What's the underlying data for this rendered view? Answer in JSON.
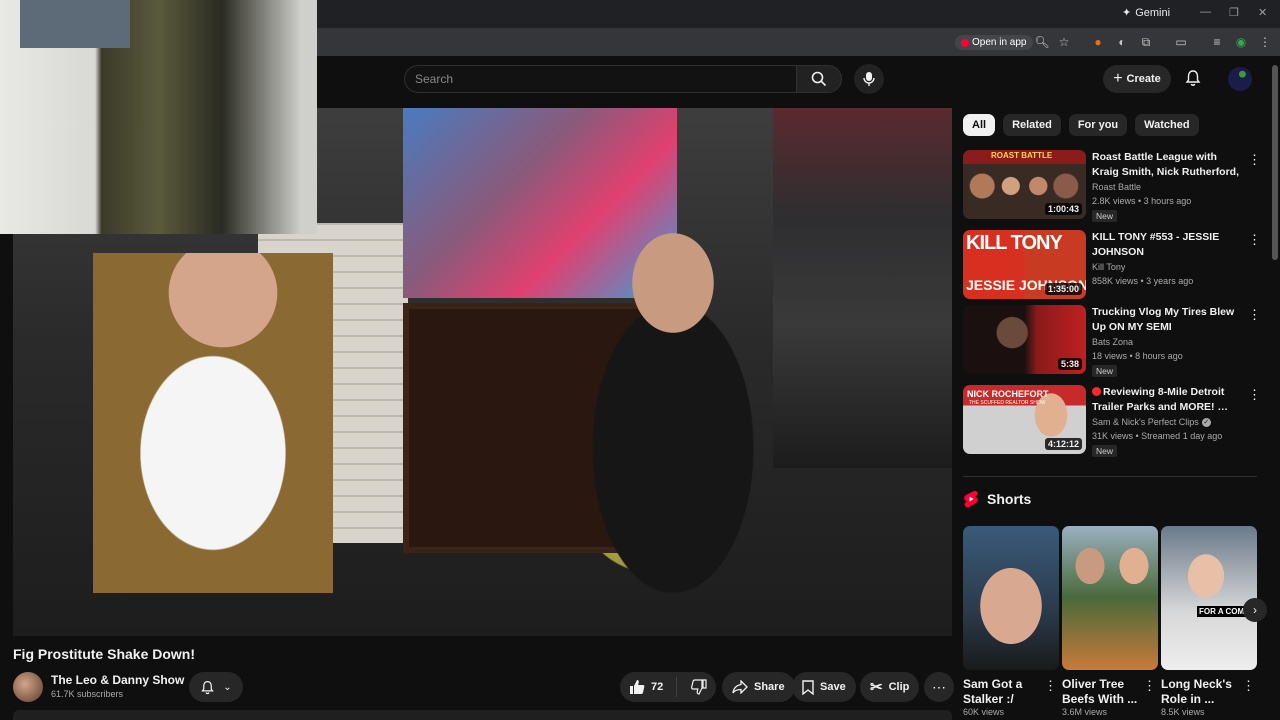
{
  "browser": {
    "gemini_label": "Gemini",
    "open_in_app": "Open in app"
  },
  "header": {
    "search_placeholder": "Search",
    "create_label": "Create"
  },
  "video": {
    "title": "Fig Prostitute Shake Down!",
    "channel": "The Leo & Danny Show",
    "subscribers": "61.7K subscribers",
    "likes": "72",
    "share_label": "Share",
    "save_label": "Save",
    "clip_label": "Clip"
  },
  "chips": [
    "All",
    "Related",
    "For you",
    "Watched"
  ],
  "recommendations": [
    {
      "title": "Roast Battle League with Kraig Smith, Nick Rutherford, Darius...",
      "channel": "Roast Battle",
      "meta": "2.8K views • 3 hours ago",
      "badge": "New",
      "duration": "1:00:43",
      "verified": false,
      "live_dot": false
    },
    {
      "title": "KILL TONY #553 - JESSIE JOHNSON",
      "channel": "Kill Tony",
      "meta": "858K views • 3 years ago",
      "badge": "",
      "duration": "1:35:00",
      "verified": false,
      "live_dot": false
    },
    {
      "title": "Trucking Vlog My Tires Blew Up ON MY SEMI",
      "channel": "Bats Zona",
      "meta": "18 views • 8 hours ago",
      "badge": "New",
      "duration": "5:38",
      "verified": false,
      "live_dot": false
    },
    {
      "title": "Reviewing 8-Mile Detroit Trailer Parks and MORE! …",
      "channel": "Sam & Nick's Perfect Clips",
      "meta": "31K views • Streamed 1 day ago",
      "badge": "New",
      "duration": "4:12:12",
      "verified": true,
      "live_dot": true
    }
  ],
  "shorts": {
    "heading": "Shorts",
    "items": [
      {
        "title": "Sam Got a Stalker :/",
        "views": "60K views"
      },
      {
        "title": "Oliver Tree Beefs With ...",
        "views": "3.6M views"
      },
      {
        "title": "Long Neck's Role in ...",
        "views": "8.5K views"
      }
    ]
  },
  "thumb_texts": {
    "rec1_top": "ROAST BATTLE",
    "rec2_text": "KILL TONY",
    "rec2_sub": "JESSIE JOHNSON",
    "rec4_name": "NICK ROCHEFORT",
    "rec4_sub": "THE SCUFFED REALTOR SHOW",
    "short3_caption": "FOR A COMPLIMENT"
  },
  "colors": {
    "accent": "#ff0033",
    "bg": "#0f0f0f",
    "chip_bg": "#272727"
  }
}
